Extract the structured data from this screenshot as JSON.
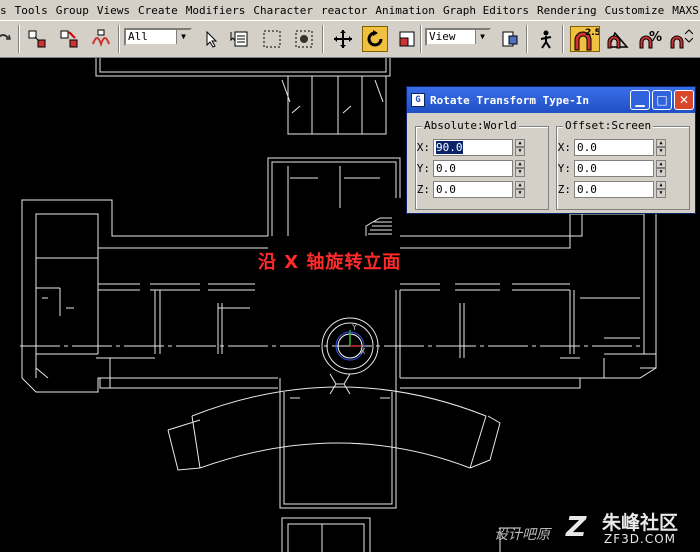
{
  "menu": {
    "items": [
      "s",
      "Tools",
      "Group",
      "Views",
      "Create",
      "Modifiers",
      "Character",
      "reactor",
      "Animation",
      "Graph Editors",
      "Rendering",
      "Customize",
      "MAXS"
    ]
  },
  "toolbar": {
    "selection_filter": "All",
    "reference_coord": "View",
    "snap_value": "2.5"
  },
  "viewport": {
    "caption": "沿 X 轴旋转立面"
  },
  "dialog": {
    "title": "Rotate Transform Type-In",
    "absolute": {
      "title": "Absolute:World",
      "x_label": "X:",
      "x": "90.0",
      "y_label": "Y:",
      "y": "0.0",
      "z_label": "Z:",
      "z": "0.0"
    },
    "offset": {
      "title": "Offset:Screen",
      "x_label": "X:",
      "x": "0.0",
      "y_label": "Y:",
      "y": "0.0",
      "z_label": "Z:",
      "z": "0.0"
    }
  },
  "watermark": {
    "cn": "朱峰社区",
    "en": "ZF3D.COM",
    "site_cn": "设计吧原"
  }
}
